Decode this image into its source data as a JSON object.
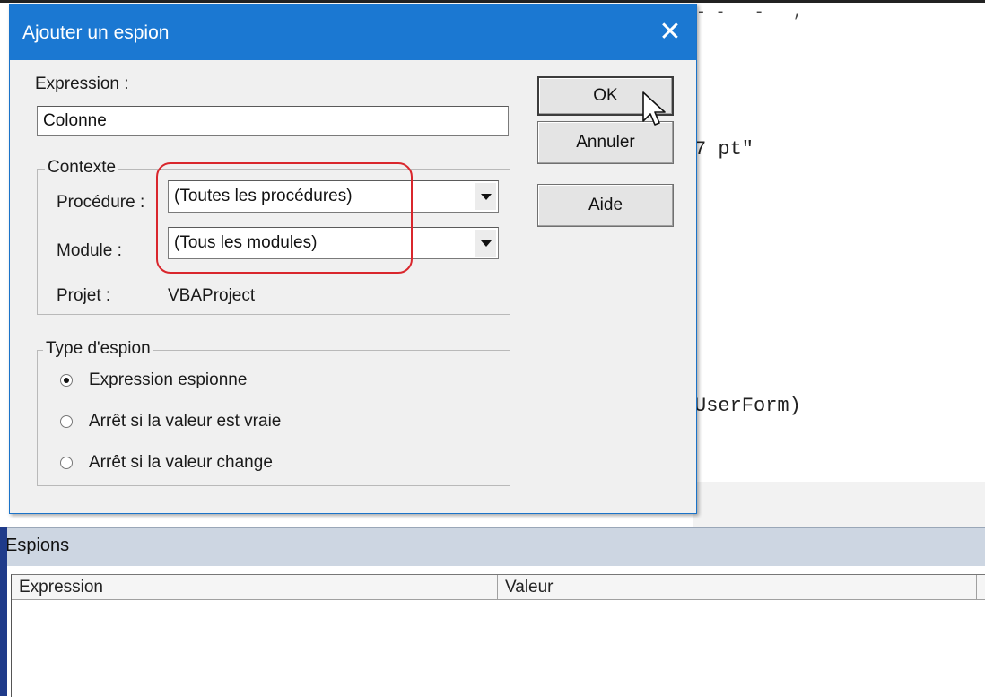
{
  "dialog": {
    "title": "Ajouter un espion",
    "close_glyph": "✕",
    "expression_label": "Expression :",
    "expression_value": "Colonne",
    "context": {
      "legend": "Contexte",
      "procedure_label": "Procédure :",
      "procedure_value": "(Toutes les procédures)",
      "module_label": "Module :",
      "module_value": "(Tous les modules)",
      "project_label": "Projet :",
      "project_value": "VBAProject"
    },
    "watch_type": {
      "legend": "Type d'espion",
      "options": [
        {
          "label": "Expression espionne",
          "selected": true
        },
        {
          "label": "Arrêt si la valeur est vraie",
          "selected": false
        },
        {
          "label": "Arrêt si la valeur change",
          "selected": false
        }
      ]
    },
    "buttons": {
      "ok": "OK",
      "cancel": "Annuler",
      "help": "Aide"
    },
    "highlight_color": "#d9262c",
    "title_color": "#1b78d2"
  },
  "editor": {
    "code_fragments": [
      "7 pt\"",
      "UserForm)"
    ]
  },
  "watch_window": {
    "title": "Espions",
    "columns": [
      "Expression",
      "Valeur"
    ]
  }
}
